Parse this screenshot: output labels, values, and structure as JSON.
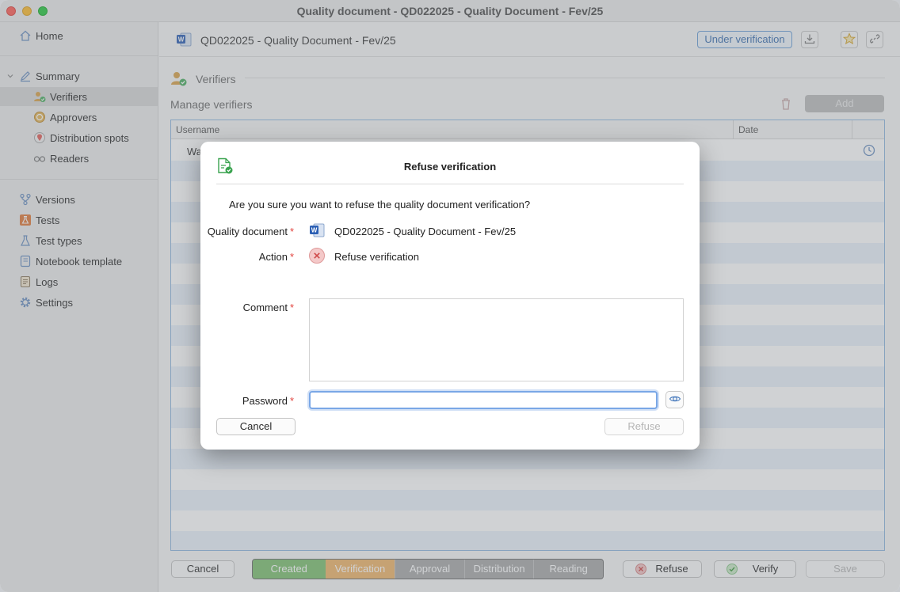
{
  "window": {
    "title": "Quality document - QD022025 - Quality Document - Fev/25"
  },
  "sidebar": {
    "home": "Home",
    "summary": "Summary",
    "verifiers": "Verifiers",
    "approvers": "Approvers",
    "distribution": "Distribution spots",
    "readers": "Readers",
    "versions": "Versions",
    "tests": "Tests",
    "test_types": "Test types",
    "notebook": "Notebook template",
    "logs": "Logs",
    "settings": "Settings"
  },
  "header": {
    "doc_title": "QD022025 - Quality Document - Fev/25",
    "status": "Under verification",
    "download_icon": "download-icon",
    "favorite_icon": "star-icon",
    "link_icon": "link-icon"
  },
  "verifiers_section": {
    "title": "Verifiers",
    "manage_label": "Manage verifiers",
    "add_label": "Add",
    "columns": {
      "username": "Username",
      "date": "Date"
    },
    "rows": [
      {
        "username": "Wa"
      }
    ]
  },
  "bottom": {
    "cancel": "Cancel",
    "refuse": "Refuse",
    "verify": "Verify",
    "save": "Save",
    "workflow": [
      "Created",
      "Verification",
      "Approval",
      "Distribution",
      "Reading"
    ]
  },
  "dialog": {
    "title": "Refuse verification",
    "question": "Are you sure you want to refuse the quality document verification?",
    "quality_document_label": "Quality document",
    "quality_document_value": "QD022025 - Quality Document - Fev/25",
    "action_label": "Action",
    "action_value": "Refuse verification",
    "comment_label": "Comment",
    "comment_value": "",
    "password_label": "Password",
    "password_value": "",
    "required_mark": "*",
    "cancel": "Cancel",
    "refuse": "Refuse"
  },
  "colors": {
    "accent_blue": "#6a9ed6",
    "created_green": "#7fc070",
    "verification_orange": "#f0b56a",
    "required_red": "#e2433e"
  }
}
